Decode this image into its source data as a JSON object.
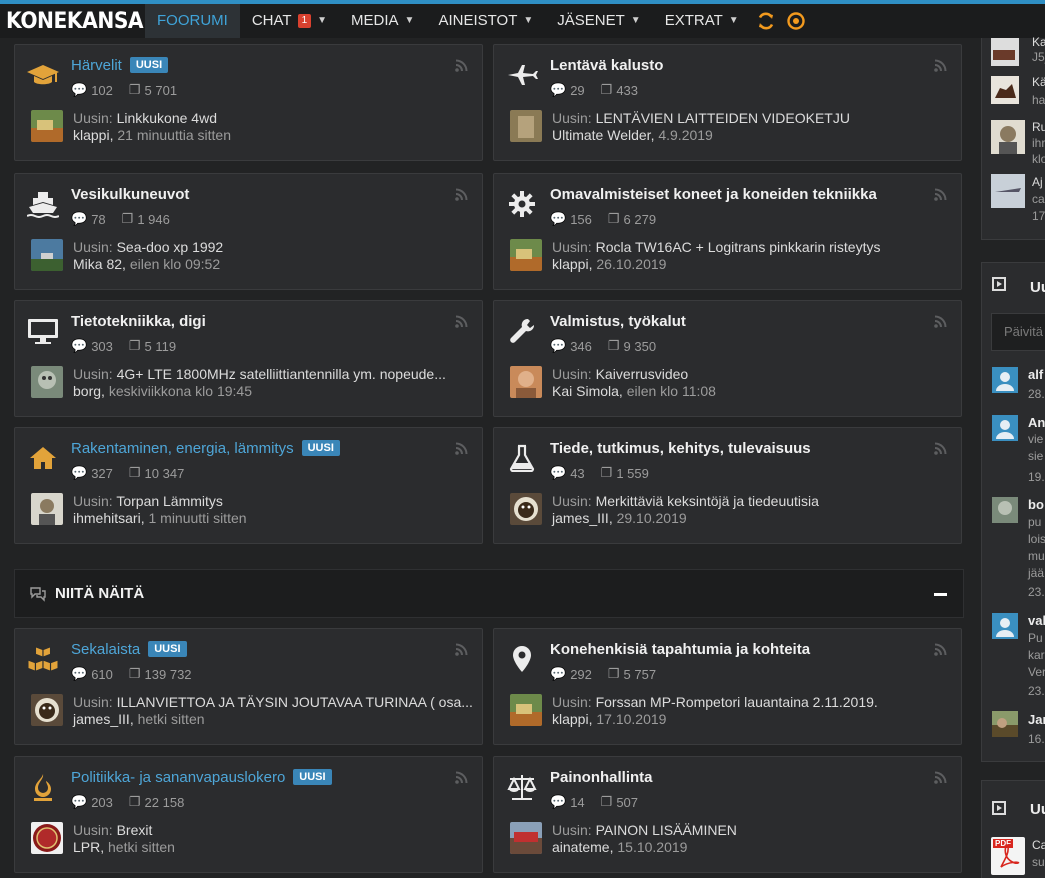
{
  "header": {
    "logo": "KONEKANSA",
    "nav": [
      {
        "label": "FOORUMI",
        "active": true
      },
      {
        "label": "CHAT",
        "badge": "1",
        "caret": true
      },
      {
        "label": "MEDIA",
        "caret": true
      },
      {
        "label": "AINEISTOT",
        "caret": true
      },
      {
        "label": "JÄSENET",
        "caret": true
      },
      {
        "label": "EXTRAT",
        "caret": true
      }
    ],
    "icons": [
      "refresh-icon",
      "target-icon"
    ]
  },
  "common": {
    "new_badge": "UUSI",
    "latest_prefix": "Uusin:"
  },
  "forums": [
    {
      "title": "Härvelit",
      "new": true,
      "icon": "graduation-cap-icon",
      "threads": "102",
      "posts": "5 701",
      "latest": "Linkkukone 4wd",
      "user": "klappi",
      "time": "21 minuuttia sitten"
    },
    {
      "title": "Lentävä kalusto",
      "new": false,
      "icon": "plane-icon",
      "threads": "29",
      "posts": "433",
      "latest": "LENTÄVIEN LAITTEIDEN VIDEOKETJU",
      "user": "Ultimate Welder",
      "time": "4.9.2019"
    },
    {
      "title": "Vesikulkuneuvot",
      "new": false,
      "icon": "ship-icon",
      "threads": "78",
      "posts": "1 946",
      "latest": "Sea-doo xp 1992",
      "user": "Mika 82",
      "time": "eilen klo 09:52"
    },
    {
      "title": "Omavalmisteiset koneet ja koneiden tekniikka",
      "new": false,
      "icon": "gear-icon",
      "threads": "156",
      "posts": "6 279",
      "latest": "Rocla TW16AC + Logitrans pinkkarin risteytys",
      "user": "klappi",
      "time": "26.10.2019"
    },
    {
      "title": "Tietotekniikka, digi",
      "new": false,
      "icon": "monitor-icon",
      "threads": "303",
      "posts": "5 119",
      "latest": "4G+ LTE 1800MHz satelliittiantennilla ym. nopeude...",
      "user": "borg",
      "time": "keskiviikkona klo 19:45"
    },
    {
      "title": "Valmistus, työkalut",
      "new": false,
      "icon": "wrench-icon",
      "threads": "346",
      "posts": "9 350",
      "latest": "Kaiverrusvideo",
      "user": "Kai Simola",
      "time": "eilen klo 11:08"
    },
    {
      "title": "Rakentaminen, energia, lämmitys",
      "new": true,
      "icon": "house-icon",
      "threads": "327",
      "posts": "10 347",
      "latest": "Torpan Lämmitys",
      "user": "ihmehitsari",
      "time": "1 minuutti sitten"
    },
    {
      "title": "Tiede, tutkimus, kehitys, tulevaisuus",
      "new": false,
      "icon": "flask-icon",
      "threads": "43",
      "posts": "1 559",
      "latest": "Merkittäviä keksintöjä ja tiedeuutisia",
      "user": "james_III",
      "time": "29.10.2019"
    }
  ],
  "section": {
    "title": "NIITÄ NÄITÄ"
  },
  "forums2": [
    {
      "title": "Sekalaista",
      "new": true,
      "icon": "boxes-icon",
      "threads": "610",
      "posts": "139 732",
      "latest": "ILLANVIETTOA JA TÄYSIN JOUTAVAA TURINAA ( osa...",
      "user": "james_III",
      "time": "hetki sitten"
    },
    {
      "title": "Konehenkisiä tapahtumia ja kohteita",
      "new": false,
      "icon": "map-pin-icon",
      "threads": "292",
      "posts": "5 757",
      "latest": "Forssan MP-Rompetori lauantaina 2.11.2019.",
      "user": "klappi",
      "time": "17.10.2019"
    },
    {
      "title": "Politiikka- ja sananvapauslokero",
      "new": true,
      "icon": "fire-icon",
      "threads": "203",
      "posts": "22 158",
      "latest": "Brexit",
      "user": "LPR",
      "time": "hetki sitten"
    },
    {
      "title": "Painonhallinta",
      "new": false,
      "icon": "scale-icon",
      "threads": "14",
      "posts": "507",
      "latest": "PAINON LISÄÄMINEN",
      "user": "ainateme",
      "time": "15.10.2019"
    }
  ],
  "sidebar": {
    "top_items": [
      {
        "l1": "Ka",
        "l2": "J5_"
      },
      {
        "l1": "Kä",
        "l2": "ha"
      },
      {
        "l1": "Ru",
        "l2": "ihr",
        "l3": "klo"
      },
      {
        "l1": "Aj",
        "l2": "ca",
        "l3": "17."
      }
    ],
    "box2_title": "Uu",
    "search_placeholder": "Päivitä",
    "updates": [
      {
        "name": "alf",
        "lines": [
          "28."
        ]
      },
      {
        "name": "An",
        "lines": [
          "vie",
          "sie",
          "19."
        ]
      },
      {
        "name": "bo",
        "lines": [
          "pu",
          "lois",
          "mu",
          "jää",
          "23."
        ]
      },
      {
        "name": "val",
        "lines": [
          "Pu",
          "kar",
          "Ver",
          "23."
        ]
      },
      {
        "name": "Jar",
        "lines": [
          "16."
        ]
      }
    ],
    "box3_title": "Uu",
    "box3_items": [
      {
        "l1": "Ca",
        "l2": "su"
      }
    ]
  }
}
